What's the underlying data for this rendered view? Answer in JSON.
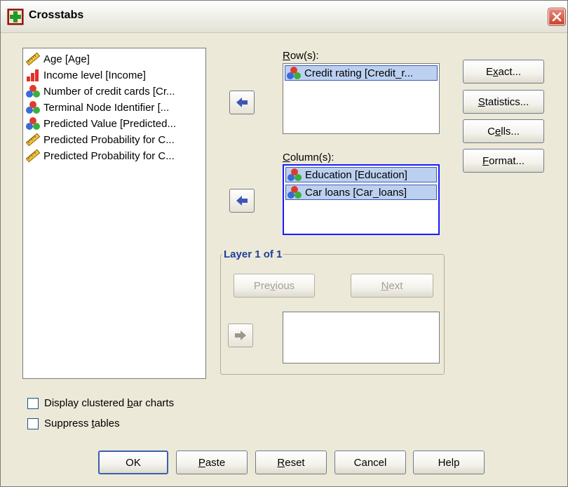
{
  "window": {
    "title": "Crosstabs",
    "close_icon": "close-x-icon"
  },
  "variables": [
    {
      "label": "Age [Age]",
      "icon": "scale-ruler-icon"
    },
    {
      "label": "Income level [Income]",
      "icon": "ordinal-bars-icon"
    },
    {
      "label": "Number of credit cards [Cr...",
      "icon": "nominal-circles-icon"
    },
    {
      "label": "Terminal Node Identifier [...",
      "icon": "nominal-circles-icon"
    },
    {
      "label": "Predicted Value [Predicted...",
      "icon": "nominal-circles-icon"
    },
    {
      "label": "Predicted Probability for C...",
      "icon": "scale-ruler-icon"
    },
    {
      "label": "Predicted Probability for C...",
      "icon": "scale-ruler-icon"
    }
  ],
  "rows": {
    "label_pre": "",
    "label_key": "R",
    "label_post": "ow(s):",
    "items": [
      {
        "label": "Credit rating [Credit_r...",
        "icon": "nominal-circles-icon"
      }
    ]
  },
  "columns": {
    "label_pre": "",
    "label_key": "C",
    "label_post": "olumn(s):",
    "items": [
      {
        "label": "Education [Education]",
        "icon": "nominal-circles-icon"
      },
      {
        "label": "Car loans [Car_loans]",
        "icon": "nominal-circles-icon"
      }
    ]
  },
  "layer": {
    "title": "Layer 1 of 1",
    "previous": {
      "pre": "Pre",
      "key": "v",
      "post": "ious"
    },
    "next": {
      "pre": "",
      "key": "N",
      "post": "ext"
    }
  },
  "side_buttons": {
    "exact": {
      "pre": "E",
      "key": "x",
      "post": "act..."
    },
    "statistics": {
      "pre": "",
      "key": "S",
      "post": "tatistics..."
    },
    "cells": {
      "pre": "C",
      "key": "e",
      "post": "lls..."
    },
    "format": {
      "pre": "",
      "key": "F",
      "post": "ormat..."
    }
  },
  "options": {
    "clustered": {
      "pre": "Display clustered ",
      "key": "b",
      "post": "ar charts",
      "checked": false
    },
    "suppress": {
      "pre": "Suppress ",
      "key": "t",
      "post": "ables",
      "checked": false
    }
  },
  "bottom_buttons": {
    "ok": "OK",
    "paste": {
      "pre": "",
      "key": "P",
      "post": "aste"
    },
    "reset": {
      "pre": "",
      "key": "R",
      "post": "eset"
    },
    "cancel": "Cancel",
    "help": "Help"
  },
  "colors": {
    "selection_bg": "#bcd0f0",
    "focus_border": "#1a1aff",
    "arrow_blue": "#3d56b8"
  }
}
